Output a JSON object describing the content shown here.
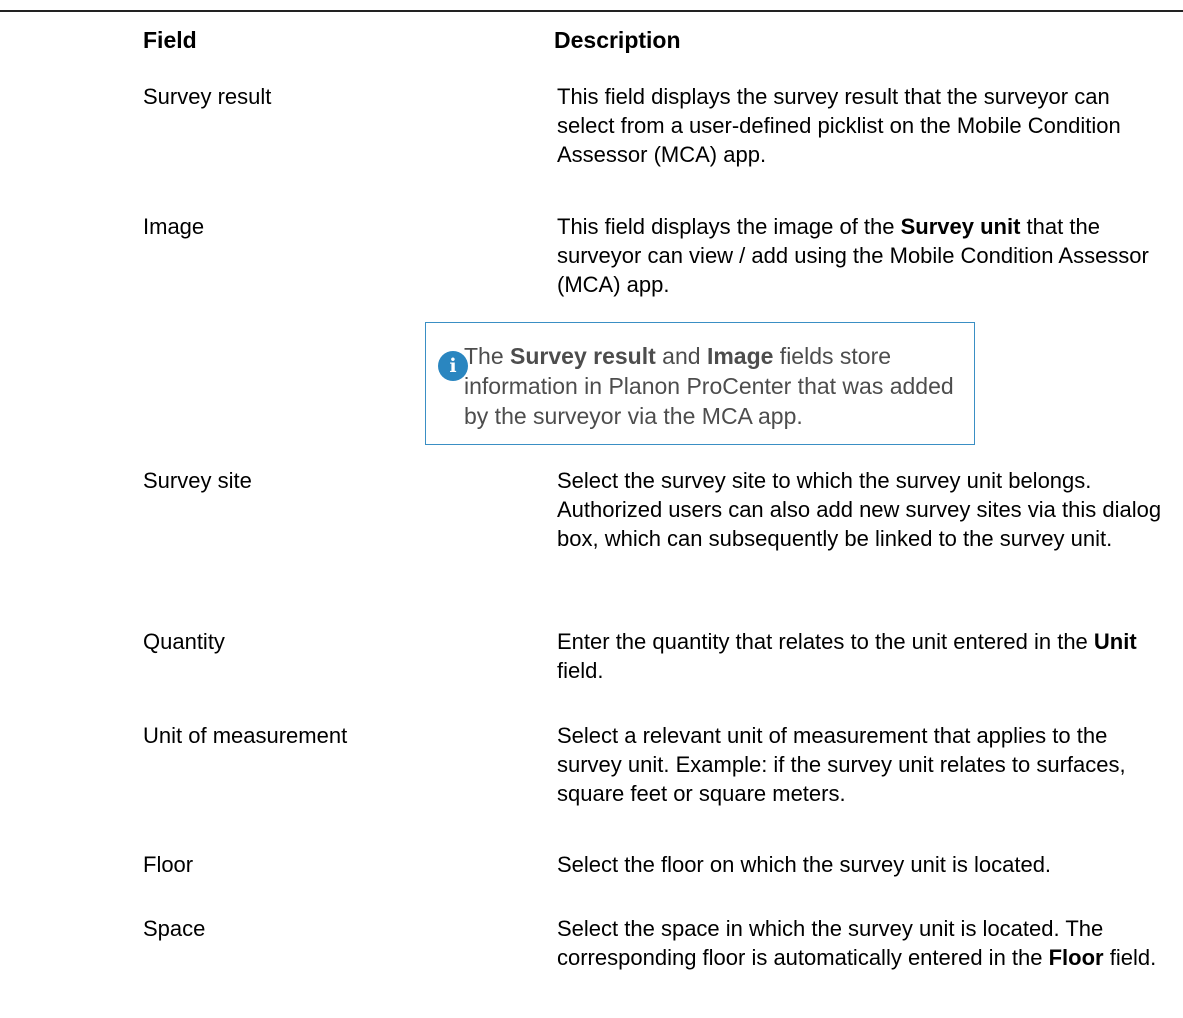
{
  "table": {
    "header": {
      "field": "Field",
      "description": "Description"
    },
    "rows": [
      {
        "field": "Survey result",
        "description": [
          {
            "text": "This field displays the survey result that the surveyor can select from a user-defined picklist on the Mobile Condition Assessor (MCA) app.",
            "bold": false
          }
        ]
      },
      {
        "field": "Image",
        "description": [
          {
            "text": "This field displays the image of the ",
            "bold": false
          },
          {
            "text": "Survey unit",
            "bold": true
          },
          {
            "text": " that the surveyor can view / add using the Mobile Condition Assessor (MCA) app.",
            "bold": false
          }
        ]
      },
      {
        "field": "Survey site",
        "description": [
          {
            "text": "Select the survey site to which the survey unit belongs. Authorized users can also add new survey sites via this dialog box, which can subsequently be linked to the survey unit.",
            "bold": false
          }
        ]
      },
      {
        "field": "Quantity",
        "description": [
          {
            "text": "Enter the quantity that relates to the unit entered in the ",
            "bold": false
          },
          {
            "text": "Unit",
            "bold": true
          },
          {
            "text": " field.",
            "bold": false
          }
        ]
      },
      {
        "field": "Unit of measurement",
        "description": [
          {
            "text": "Select a relevant unit of measurement that applies to the survey unit. Example: if the survey unit relates to surfaces, square feet or square meters.",
            "bold": false
          }
        ]
      },
      {
        "field": "Floor",
        "description": [
          {
            "text": "Select the floor on which the survey unit is located.",
            "bold": false
          }
        ]
      },
      {
        "field": "Space",
        "description": [
          {
            "text": "Select the space in which the survey unit is located. The corresponding floor is automatically entered in the ",
            "bold": false
          },
          {
            "text": "Floor",
            "bold": true
          },
          {
            "text": " field.",
            "bold": false
          }
        ]
      }
    ]
  },
  "note": {
    "icon": "info-icon",
    "icon_glyph": "i",
    "segments": [
      {
        "text": "The ",
        "bold": false
      },
      {
        "text": "Survey result",
        "bold": true
      },
      {
        "text": " and ",
        "bold": false
      },
      {
        "text": "Image",
        "bold": true
      },
      {
        "text": " fields store information in Planon ProCenter that was added by the surveyor via the MCA app.",
        "bold": false
      }
    ]
  },
  "colors": {
    "note_border": "#3a8fc4",
    "note_icon": "#2a86c0",
    "note_text": "#4d4d4d"
  }
}
